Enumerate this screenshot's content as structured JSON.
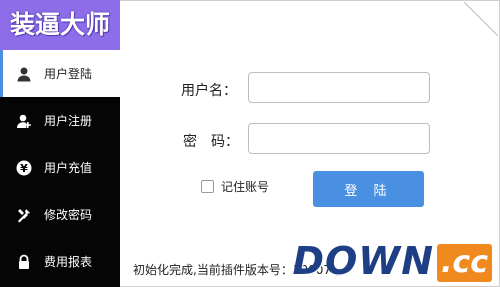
{
  "app": {
    "logo_text": "装逼大师",
    "accent_color": "#8d6ee8",
    "button_color": "#4a90e2"
  },
  "sidebar": {
    "items": [
      {
        "label": "用户登陆",
        "icon": "user-icon"
      },
      {
        "label": "用户注册",
        "icon": "add-user-icon"
      },
      {
        "label": "用户充值",
        "icon": "yen-icon"
      },
      {
        "label": "修改密码",
        "icon": "tools-icon"
      },
      {
        "label": "费用报表",
        "icon": "lock-icon"
      }
    ]
  },
  "login": {
    "username_label": "用户名：",
    "password_label": "密　码：",
    "username_value": "",
    "password_value": "",
    "remember_label": "记住账号",
    "submit_label": "登 陆"
  },
  "status": {
    "text": "初始化完成,当前插件版本号：10007 ,"
  },
  "watermark": {
    "main": "DOWN",
    "suffix": ".cc"
  }
}
